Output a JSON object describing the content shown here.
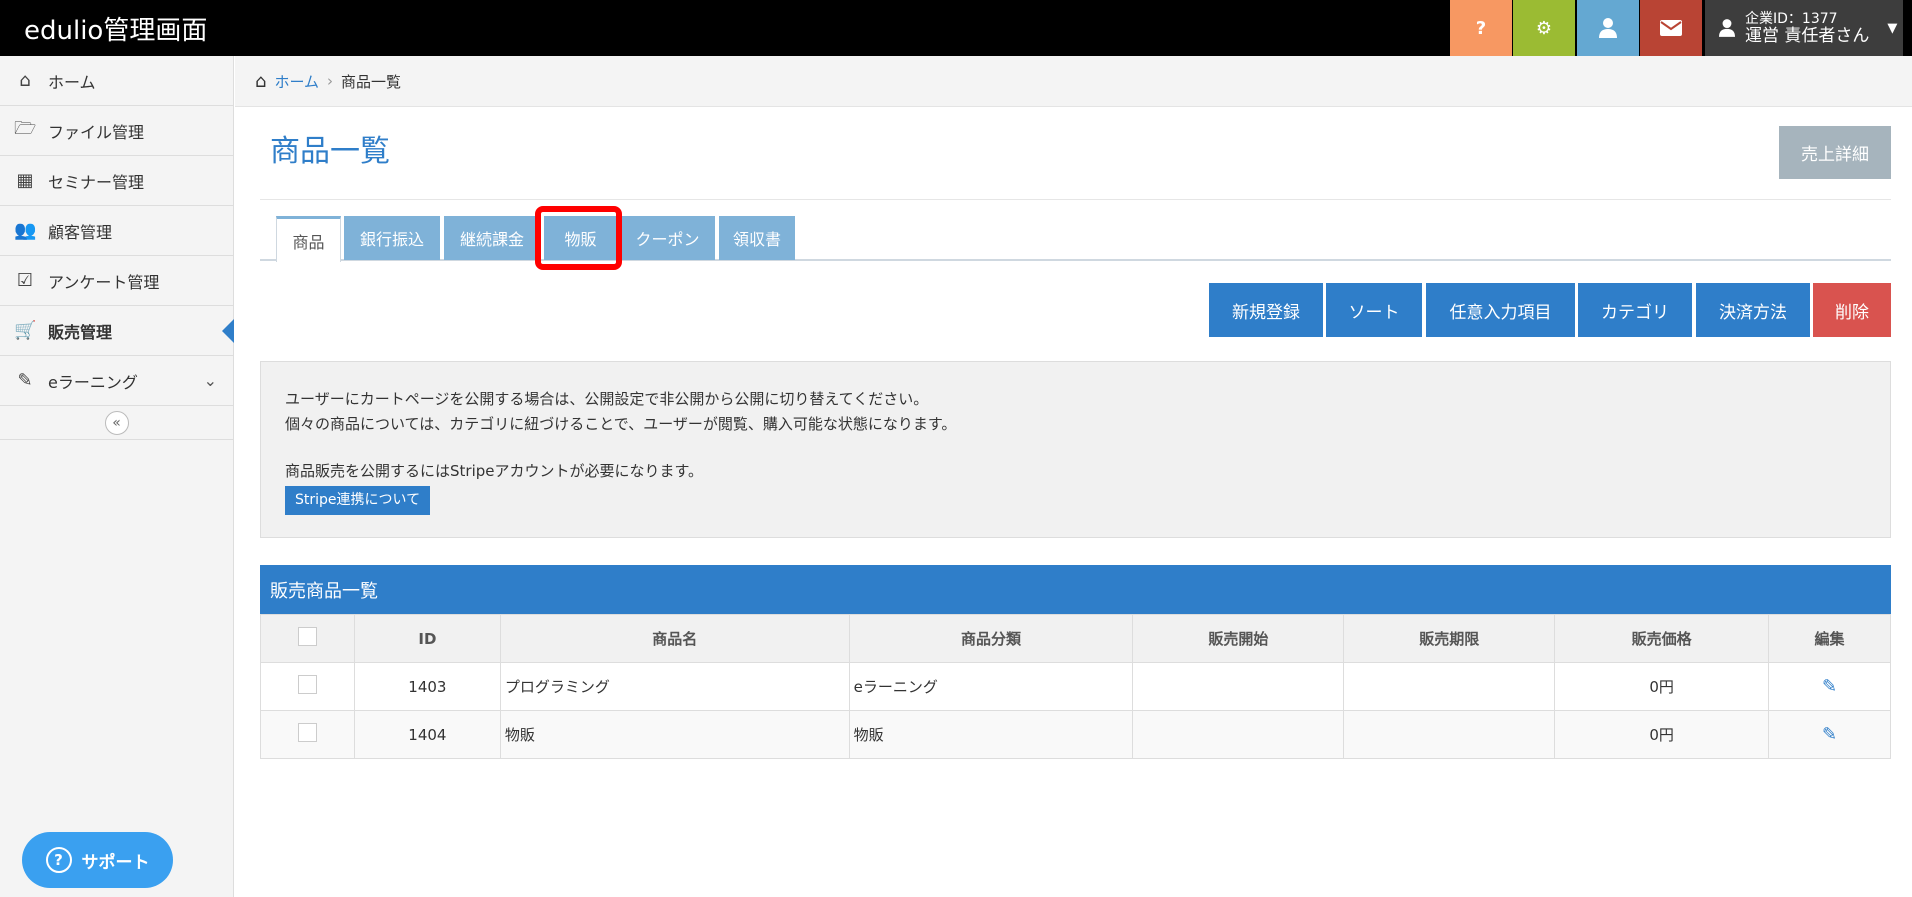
{
  "header": {
    "brand": "edulio管理画面",
    "company_id": "企業ID：1377",
    "user_name": "運営 責任者さん",
    "colors": {
      "help": "#f79862",
      "settings": "#9bbb33",
      "profile": "#64a8d2",
      "mail": "#b94434"
    }
  },
  "sidebar": {
    "items": [
      {
        "label": "ホーム",
        "icon": "home-icon"
      },
      {
        "label": "ファイル管理",
        "icon": "folder-icon"
      },
      {
        "label": "セミナー管理",
        "icon": "calendar-icon"
      },
      {
        "label": "顧客管理",
        "icon": "users-icon"
      },
      {
        "label": "アンケート管理",
        "icon": "checkbox-icon"
      },
      {
        "label": "販売管理",
        "icon": "cart-icon"
      },
      {
        "label": "eラーニング",
        "icon": "pencil-icon"
      }
    ],
    "support": "サポート"
  },
  "breadcrumb": {
    "home": "ホーム",
    "current": "商品一覧"
  },
  "page": {
    "title": "商品一覧",
    "sales_detail": "売上詳細"
  },
  "tabs": [
    "商品",
    "銀行振込",
    "継続課金",
    "物販",
    "クーポン",
    "領収書"
  ],
  "actions": {
    "new": "新規登録",
    "sort": "ソート",
    "custom": "任意入力項目",
    "category": "カテゴリ",
    "payment": "決済方法",
    "delete": "削除"
  },
  "info": {
    "line1": "ユーザーにカートページを公開する場合は、公開設定で非公開から公開に切り替えてください。",
    "line2": "個々の商品については、カテゴリに紐づけることで、ユーザーが閲覧、購入可能な状態になります。",
    "line3": "商品販売を公開するにはStripeアカウントが必要になります。",
    "stripe_button": "Stripe連携について"
  },
  "table": {
    "title": "販売商品一覧",
    "columns": [
      "ID",
      "商品名",
      "商品分類",
      "販売開始",
      "販売期限",
      "販売価格",
      "編集"
    ],
    "rows": [
      {
        "id": "1403",
        "name": "プログラミング",
        "type": "eラーニング",
        "start": "",
        "end": "",
        "price": "0円"
      },
      {
        "id": "1404",
        "name": "物販",
        "type": "物販",
        "start": "",
        "end": "",
        "price": "0円"
      }
    ]
  }
}
